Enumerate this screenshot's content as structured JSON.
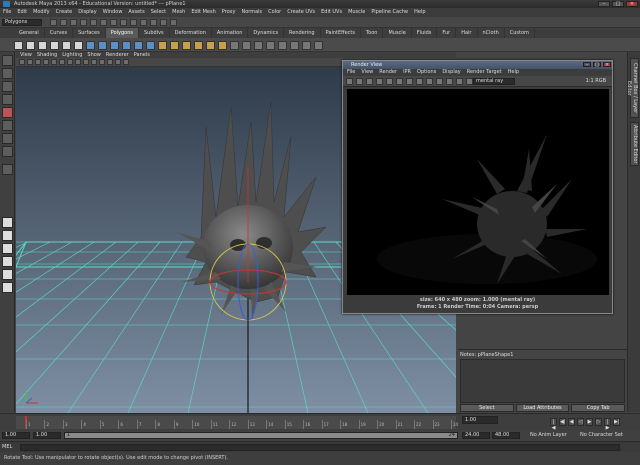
{
  "window": {
    "title": "Autodesk Maya 2013 x64 - Educational Version: untitled*   ---   pPlane1"
  },
  "menubar": [
    "File",
    "Edit",
    "Modify",
    "Create",
    "Display",
    "Window",
    "Assets",
    "Select",
    "Mesh",
    "Edit Mesh",
    "Proxy",
    "Normals",
    "Color",
    "Create UVs",
    "Edit UVs",
    "Muscle",
    "Pipeline Cache",
    "Help"
  ],
  "status_line": {
    "menu_set": "Polygons"
  },
  "shelf_tabs": [
    {
      "label": "General"
    },
    {
      "label": "Curves"
    },
    {
      "label": "Surfaces"
    },
    {
      "label": "Polygons",
      "active": true
    },
    {
      "label": "Subdivs"
    },
    {
      "label": "Deformation"
    },
    {
      "label": "Animation"
    },
    {
      "label": "Dynamics"
    },
    {
      "label": "Rendering"
    },
    {
      "label": "PaintEffects"
    },
    {
      "label": "Toon"
    },
    {
      "label": "Muscle"
    },
    {
      "label": "Fluids"
    },
    {
      "label": "Fur"
    },
    {
      "label": "Hair"
    },
    {
      "label": "nCloth"
    },
    {
      "label": "Custom"
    }
  ],
  "viewport": {
    "menu": [
      "View",
      "Shading",
      "Lighting",
      "Show",
      "Renderer",
      "Panels"
    ],
    "background_top": "#2f3b49",
    "background_bottom": "#7e8fa4",
    "grid_color": "#59dcc6"
  },
  "render_view": {
    "title": "Render View",
    "menu": [
      "File",
      "View",
      "Render",
      "IPR",
      "Options",
      "Display",
      "Render Target",
      "Help"
    ],
    "renderer": "mental ray",
    "ratio": "1:1  RGB",
    "info_line1": "size: 640 x 480  zoom: 1.000       (mental ray)",
    "info_line2": "Frame: 1       Render Time: 0:04       Camera: persp"
  },
  "side_tabs": [
    "Channel Box / Layer Editor",
    "Attribute Editor"
  ],
  "attribute_editor": {
    "notes_label": "Notes:  pPlaneShape1",
    "buttons": [
      "Select",
      "Load Attributes",
      "Copy Tab"
    ]
  },
  "time_slider": {
    "tick_labels": [
      "1",
      "2",
      "3",
      "4",
      "5",
      "6",
      "7",
      "8",
      "9",
      "10",
      "11",
      "12",
      "13",
      "14",
      "15",
      "16",
      "17",
      "18",
      "19",
      "20",
      "21",
      "22",
      "23",
      "24"
    ],
    "current_frame": "1.00",
    "current_frame_value": 1
  },
  "range_slider": {
    "start": "1.00",
    "playback_start": "1.00",
    "playback_end": "24.00",
    "end": "48.00",
    "bar_start_label": "1",
    "bar_end_label": "24",
    "anim_layer": "No Anim Layer",
    "character_set": "No Character Set"
  },
  "command_line": {
    "language": "MEL"
  },
  "help_line": "Rotate Tool: Use manipulator to rotate object(s). Use edit mode to change pivot (INSERT)."
}
